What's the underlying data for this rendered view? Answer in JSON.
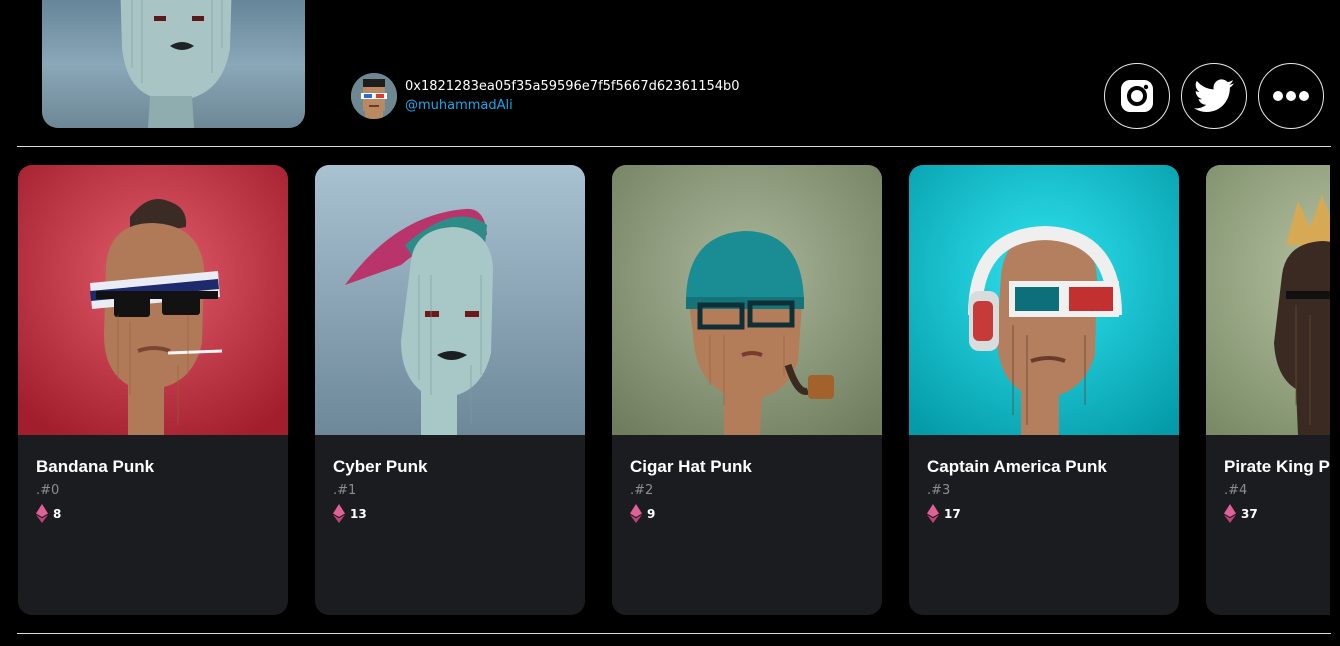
{
  "owner": {
    "address": "0x1821283ea05f35a59596e7f5f5667d62361154b0",
    "handle": "@muhammadAli"
  },
  "social": {
    "icons": [
      "instagram-icon",
      "twitter-icon",
      "more-icon"
    ]
  },
  "cards": [
    {
      "name": "Bandana Punk",
      "id": ".#0",
      "price": "8"
    },
    {
      "name": "Cyber Punk",
      "id": ".#1",
      "price": "13"
    },
    {
      "name": "Cigar Hat Punk",
      "id": ".#2",
      "price": "9"
    },
    {
      "name": "Captain America Punk",
      "id": ".#3",
      "price": "17"
    },
    {
      "name": "Pirate King Punk",
      "id": ".#4",
      "price": "37"
    }
  ],
  "colors": {
    "background": "#000000",
    "card": "#1b1c1f",
    "handle": "#1aa7ec",
    "eth": "#e0609a"
  }
}
